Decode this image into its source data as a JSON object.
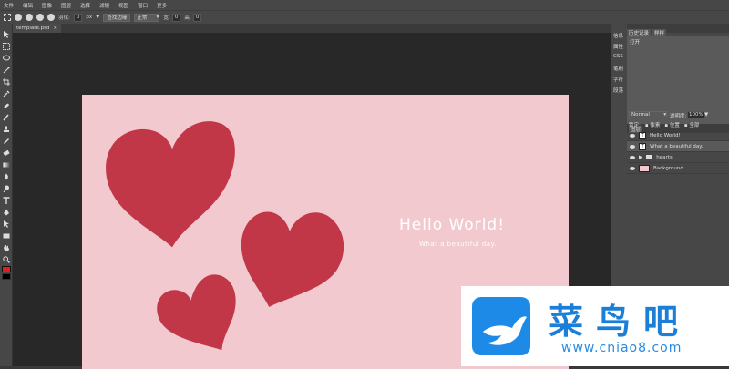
{
  "menu": [
    "文件",
    "编辑",
    "图像",
    "图层",
    "选择",
    "滤镜",
    "视图",
    "窗口",
    "更多"
  ],
  "options": {
    "feather_label": "羽化:",
    "feather_value": "0",
    "feather_unit": "px",
    "refine_edge": "查找边缘",
    "style_label": "正常",
    "width_label": "宽",
    "width_value": "0",
    "height_label": "高",
    "height_value": "0"
  },
  "document": {
    "tab_label": "template.psd",
    "close_glyph": "×"
  },
  "artwork": {
    "headline": "Hello World!",
    "subline": "What a beautiful day.",
    "background_color": "#f1c9cf",
    "heart_color": "#c13747"
  },
  "right_column": [
    "信息",
    "属性",
    "CSS",
    "笔刷",
    "字符",
    "段落"
  ],
  "panel": {
    "tabs": [
      "历史记录",
      "样样"
    ],
    "history_item": "打开",
    "layers_tab": "图层",
    "blend_mode": "Normal",
    "opacity_label": "透明度:",
    "opacity_value": "100%",
    "lock_label": "锁定:",
    "lock_pixels": "像素",
    "lock_position": "位置",
    "lock_all": "全部",
    "layers": [
      "Hello World!",
      "What a beautiful day.",
      "hearts",
      "Background"
    ]
  },
  "watermark": {
    "title": "菜鸟吧",
    "url": "www.cniao8.com",
    "brand_color": "#1b7fd8"
  }
}
